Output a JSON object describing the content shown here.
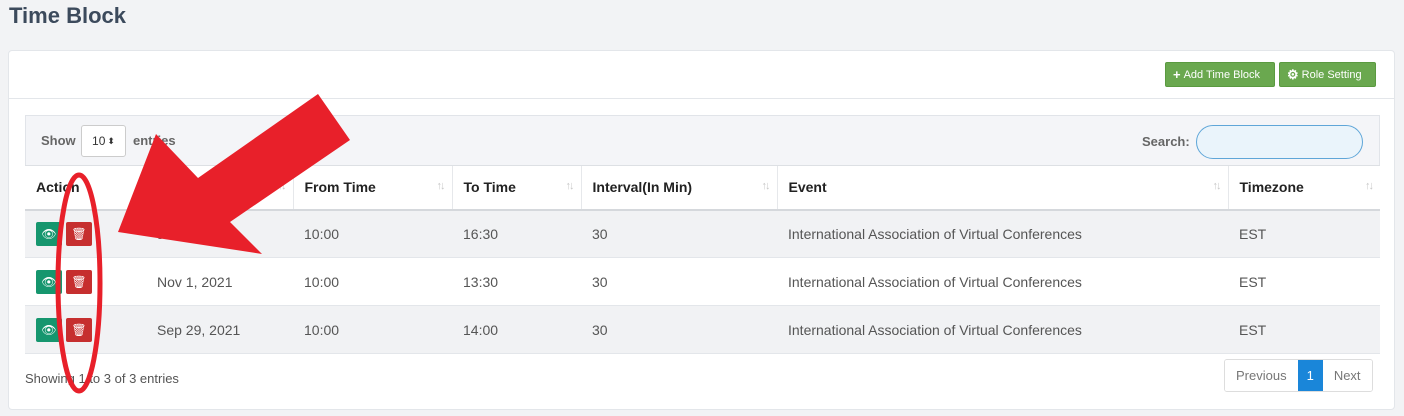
{
  "page": {
    "title": "Time Block"
  },
  "header_buttons": {
    "add_label": "Add Time Block",
    "add_icon": "plus-icon",
    "role_label": "Role Setting",
    "role_icon": "gear-icon"
  },
  "toolbar": {
    "show_label": "Show",
    "page_size": "10",
    "entries_label": "entries",
    "search_label": "Search:",
    "search_value": ""
  },
  "table": {
    "columns": [
      "Action",
      "",
      "From Time",
      "To Time",
      "Interval(In Min)",
      "Event",
      "Timezone"
    ],
    "rows": [
      {
        "date": "Jan 25, 2023",
        "from": "10:00",
        "to": "16:30",
        "interval": "30",
        "event": "International Association of Virtual Conferences",
        "timezone": "EST"
      },
      {
        "date": "Nov 1, 2021",
        "from": "10:00",
        "to": "13:30",
        "interval": "30",
        "event": "International Association of Virtual Conferences",
        "timezone": "EST"
      },
      {
        "date": "Sep 29, 2021",
        "from": "10:00",
        "to": "14:00",
        "interval": "30",
        "event": "International Association of Virtual Conferences",
        "timezone": "EST"
      }
    ]
  },
  "footer": {
    "info": "Showing 1 to 3 of 3 entries",
    "prev": "Previous",
    "page": "1",
    "next": "Next"
  },
  "colors": {
    "annotation": "#e8202a",
    "view_button": "#16966e",
    "delete_button": "#c62f2f",
    "green_button": "#6aa84f",
    "active_page": "#1a86d9"
  }
}
